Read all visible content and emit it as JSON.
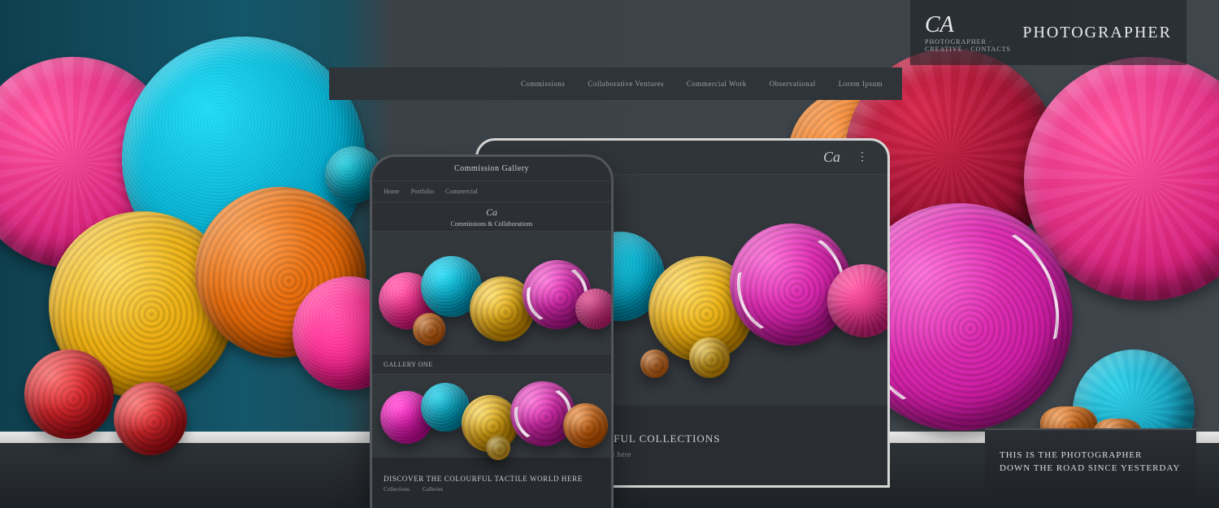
{
  "brand": {
    "script": "CA",
    "sub": "Photographer · Creative · Contacts",
    "word": "PHOTOGRAPHER"
  },
  "nav": {
    "items": [
      "Commissions",
      "Collaborative Ventures",
      "Commercial Work",
      "Observational",
      "Lorem Ipsum"
    ]
  },
  "desktop": {
    "topbar_brand": "Ca",
    "menu_icon": "⋮",
    "caption_big": "Organic & Colourful Collections",
    "caption_small": "Discover the colourful tactile world here"
  },
  "phone": {
    "header": "Commission Gallery",
    "tabs": [
      "Home",
      "Portfolio",
      "Commercial"
    ],
    "sub_brand": "Ca",
    "sub_text": "Commissions & Collaborations",
    "caption1": "Gallery One",
    "footer_title": "Discover the colourful tactile world here",
    "footer_links": [
      "Collections",
      "Galleries"
    ]
  },
  "corner": {
    "line1": "This is the photographer",
    "line2": "down the road since yesterday"
  }
}
